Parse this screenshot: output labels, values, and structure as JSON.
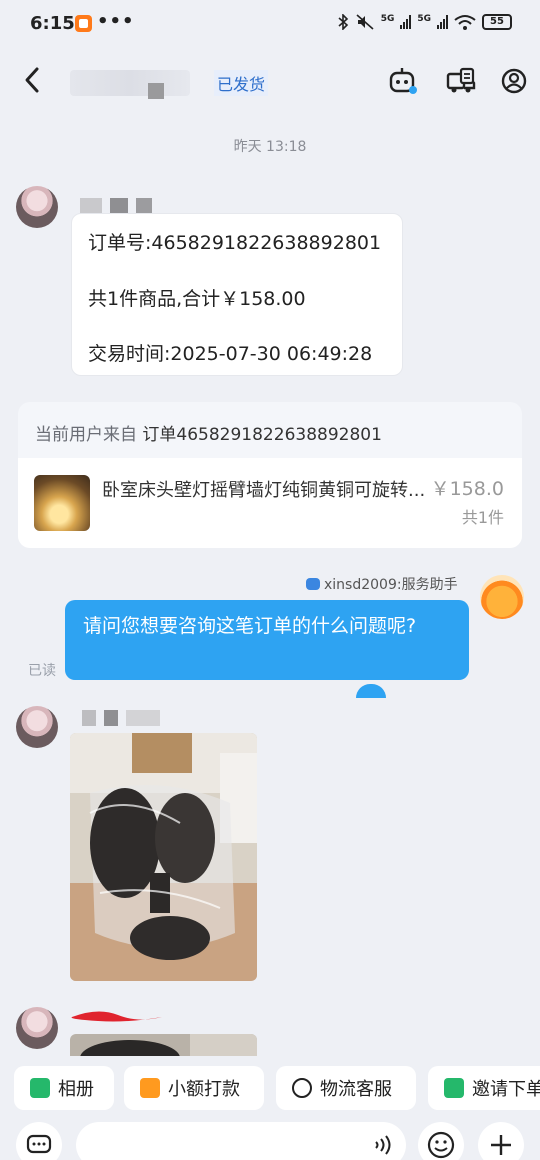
{
  "status_bar": {
    "time": "6:15",
    "dots": "•••",
    "net1": "5G",
    "net2": "5G",
    "battery": "55"
  },
  "header": {
    "status_badge": "已发货"
  },
  "timestamp": "昨天  13:18",
  "order_message": {
    "order_number": "订单号:4658291822638892801",
    "summary": "共1件商品,合计￥158.00",
    "trade_time": "交易时间:2025-07-30 06:49:28"
  },
  "source_card": {
    "prefix": "当前用户来自",
    "order_ref": "订单4658291822638892801",
    "product_title": "卧室床头壁灯摇臂墙灯纯铜黄铜可旋转...",
    "price": "￥158.0",
    "quantity": "共1件"
  },
  "assistant": {
    "label": "xinsd2009:服务助手",
    "message": "请问您想要咨询这笔订单的什么问题呢?",
    "read_status": "已读"
  },
  "quick_actions": [
    {
      "label": "相册",
      "icon": "photo-album-icon",
      "color": "#25b86b"
    },
    {
      "label": "小额打款",
      "icon": "payment-icon",
      "color": "#ff9a1f"
    },
    {
      "label": "物流客服",
      "icon": "logistics-service-icon",
      "color": "#222222"
    },
    {
      "label": "邀请下单",
      "icon": "invite-order-icon",
      "color": "#25b86b"
    }
  ],
  "colors": {
    "accent_blue": "#2ea3f2",
    "badge_blue": "#2f6fcb",
    "background": "#eef0f5"
  }
}
